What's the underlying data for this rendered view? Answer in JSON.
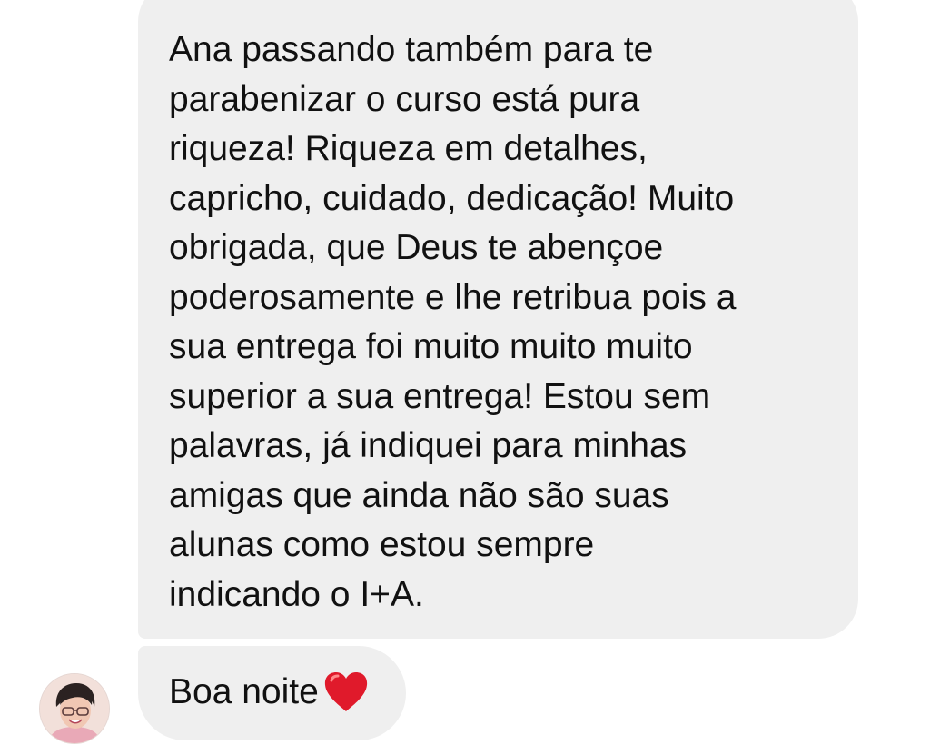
{
  "conversation": {
    "messages": [
      {
        "lines": [
          "Ana passando também para te",
          "parabenizar o curso está pura",
          "riqueza! Riqueza em detalhes,",
          "capricho, cuidado, dedicação! Muito",
          "obrigada, que Deus te abençoe",
          "poderosamente e lhe retribua pois a",
          "sua entrega foi muito muito muito",
          "superior a sua entrega! Estou sem",
          "palavras, já indiquei para minhas",
          "amigas que ainda não são suas",
          "alunas como estou sempre",
          "indicando o I+A."
        ]
      },
      {
        "text": "Boa noite",
        "emoji": "heart-icon"
      }
    ]
  },
  "colors": {
    "bubble": "#efefef",
    "text": "#111111",
    "heart": "#e01a2b"
  }
}
